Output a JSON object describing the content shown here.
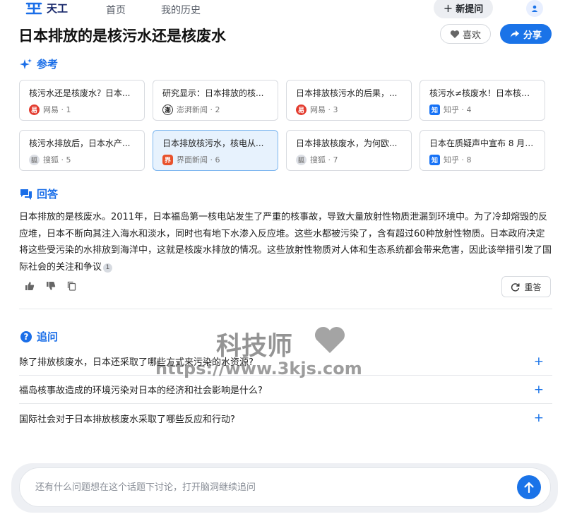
{
  "nav": {
    "brand": "天工",
    "home": "首页",
    "history": "我的历史",
    "new_question": "新提问"
  },
  "page": {
    "title": "日本排放的是核污水还是核废水",
    "like_label": "喜欢",
    "share_label": "分享"
  },
  "references": {
    "heading": "参考",
    "items": [
      {
        "title": "核污水还是核废水？日本...",
        "source": "网易",
        "index": "1",
        "icon": "wangyi"
      },
      {
        "title": "研究显示：日本排放的核...",
        "source": "澎湃新闻",
        "index": "2",
        "icon": "pengpai"
      },
      {
        "title": "日本排放核污水的后果，...",
        "source": "网易",
        "index": "3",
        "icon": "wangyi"
      },
      {
        "title": "核污水≠核废水！日本核污...",
        "source": "知乎",
        "index": "4",
        "icon": "zhihu"
      },
      {
        "title": "核污水排放后，日本水产...",
        "source": "搜狐",
        "index": "5",
        "icon": "sohu"
      },
      {
        "title": "日本排放核污水，核电从...",
        "source": "界面新闻",
        "index": "6",
        "icon": "jiemian",
        "active": true
      },
      {
        "title": "日本排放核废水，为何欧...",
        "source": "搜狐",
        "index": "7",
        "icon": "sohu"
      },
      {
        "title": "日本在质疑声中宣布 8 月 2...",
        "source": "知乎",
        "index": "8",
        "icon": "zhihu"
      }
    ]
  },
  "answer": {
    "heading": "回答",
    "text": "日本排放的是核废水。2011年，日本福岛第一核电站发生了严重的核事故，导致大量放射性物质泄漏到环境中。为了冷却熔毁的反应堆，日本不断向其注入海水和淡水，同时也有地下水渗入反应堆。这些水都被污染了，含有超过60种放射性物质。日本政府决定将这些受污染的水排放到海洋中，这就是核废水排放的情况。这些放射性物质对人体和生态系统都会带来危害，因此该举措引发了国际社会的关注和争议",
    "citation": "1",
    "regenerate_label": "重答"
  },
  "followups": {
    "heading": "追问",
    "items": [
      "除了排放核废水，日本还采取了哪些方式来污染的水资源?",
      "福岛核事故造成的环境污染对日本的经济和社会影响是什么?",
      "国际社会对于日本排放核废水采取了哪些反应和行动?"
    ]
  },
  "watermark": {
    "line1": "科技师",
    "line2": "https://www.3kjs.com"
  },
  "input": {
    "placeholder": "还有什么问题想在这个话题下讨论，打开脑洞继续追问"
  },
  "colors": {
    "accent": "#1a73e8",
    "active_card_bg": "#e7f2fd"
  }
}
